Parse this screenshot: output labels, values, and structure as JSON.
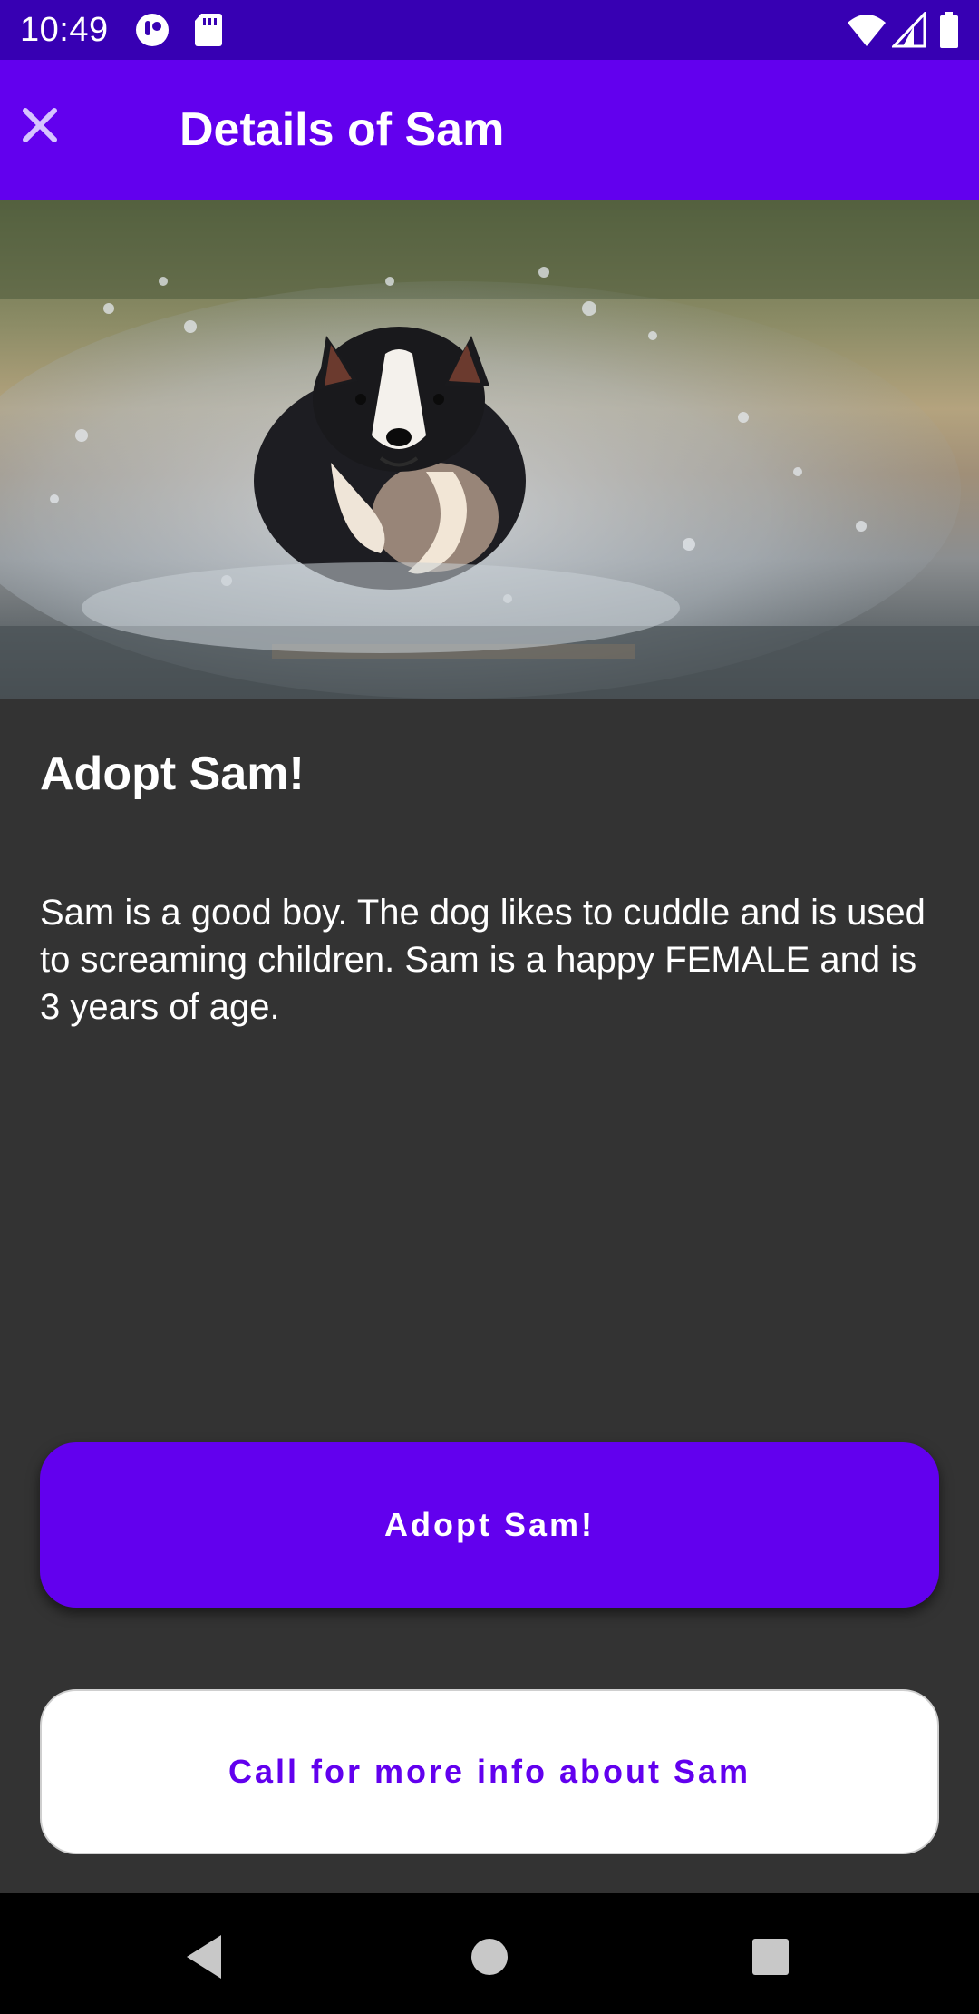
{
  "status_bar": {
    "time": "10:49",
    "icons": [
      "notification-app-icon",
      "sd-card-icon",
      "wifi-icon",
      "cell-signal-icon",
      "battery-icon"
    ]
  },
  "app_bar": {
    "title": "Details of Sam",
    "close_icon": "close-icon",
    "accent_color": "#6200ee"
  },
  "hero": {
    "subject": "dog running through water"
  },
  "content": {
    "heading": "Adopt Sam!",
    "description": "Sam is a good boy. The dog likes to cuddle and is used to screaming children. Sam is a happy FEMALE and is 3 years of age."
  },
  "actions": {
    "adopt_label": "Adopt Sam!",
    "call_label": "Call for more info about Sam"
  },
  "nav_bar": {
    "icons": [
      "back-icon",
      "home-icon",
      "recents-icon"
    ]
  }
}
